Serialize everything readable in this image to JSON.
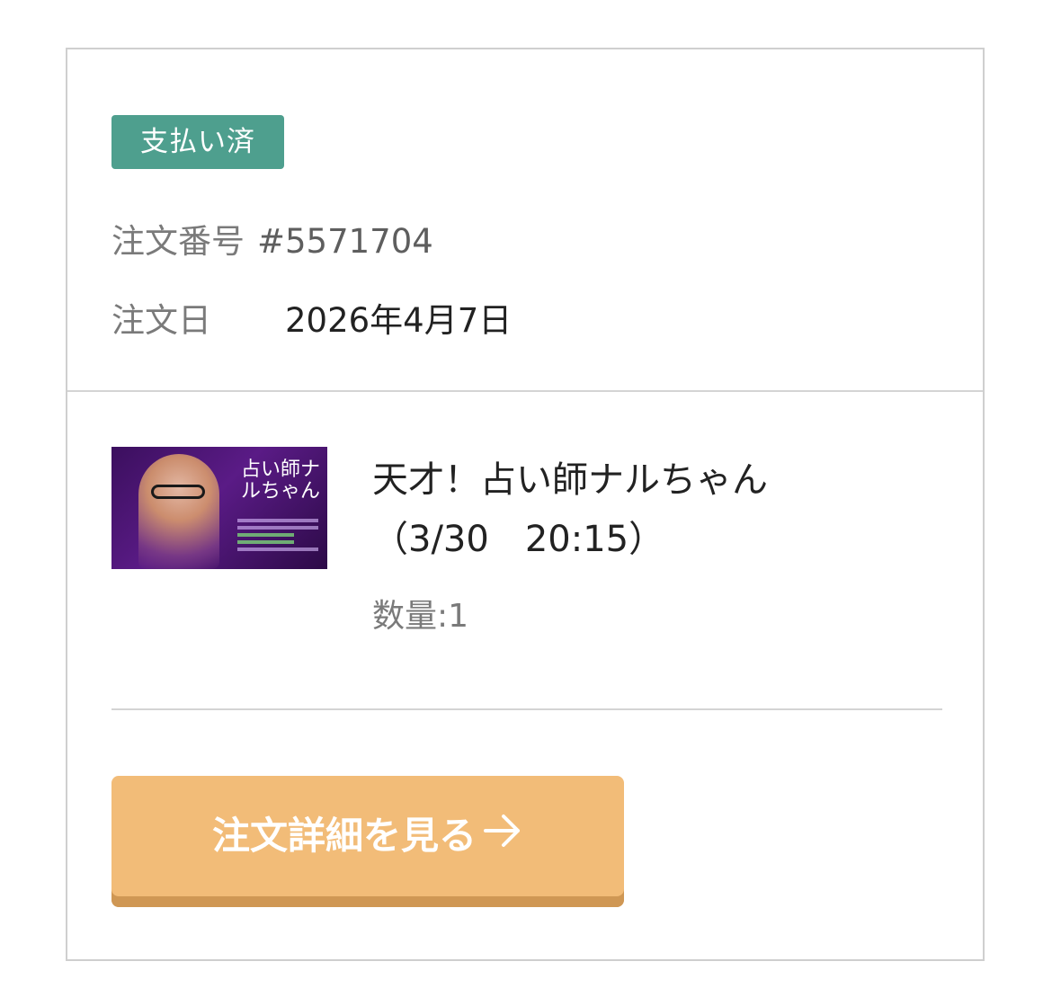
{
  "order": {
    "status_badge": "支払い済",
    "number_label": "注文番号",
    "number_value": "#5571704",
    "date_label": "注文日",
    "date_value": "2026年4月7日"
  },
  "item": {
    "thumbnail_title": "占い師ナルちゃん",
    "title_line1": "天才！占い師ナルちゃん",
    "title_line2": "（3/30　20:15）",
    "quantity": "数量:1"
  },
  "actions": {
    "detail_button_label": "注文詳細を見る",
    "detail_button_icon": "arrow-right-icon"
  },
  "colors": {
    "badge": "#4e9f8e",
    "button": "#f2bc78",
    "button_shadow": "#cf9754"
  }
}
